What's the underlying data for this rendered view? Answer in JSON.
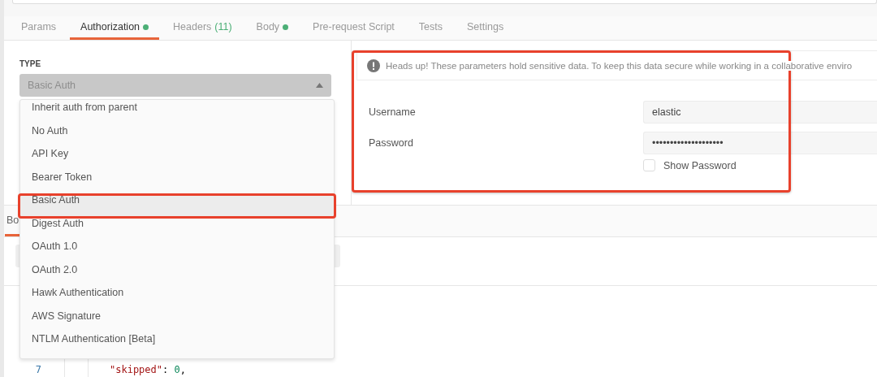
{
  "tabs": [
    {
      "label": "Params",
      "selected": false
    },
    {
      "label": "Authorization",
      "selected": true,
      "dot": true
    },
    {
      "label": "Headers",
      "selected": false,
      "count": "(11)"
    },
    {
      "label": "Body",
      "selected": false,
      "dot": true
    },
    {
      "label": "Pre-request Script",
      "selected": false
    },
    {
      "label": "Tests",
      "selected": false
    },
    {
      "label": "Settings",
      "selected": false
    }
  ],
  "auth_type": {
    "label": "TYPE",
    "value": "Basic Auth",
    "expanded": true,
    "options": [
      {
        "label": "Inherit auth from parent",
        "selected": false,
        "highlighted": false
      },
      {
        "label": "No Auth",
        "selected": false,
        "highlighted": false
      },
      {
        "label": "API Key",
        "selected": false,
        "highlighted": false
      },
      {
        "label": "Bearer Token",
        "selected": false,
        "highlighted": false
      },
      {
        "label": "Basic Auth",
        "selected": true,
        "highlighted": true
      },
      {
        "label": "Digest Auth",
        "selected": false,
        "highlighted": false
      },
      {
        "label": "OAuth 1.0",
        "selected": false,
        "highlighted": false
      },
      {
        "label": "OAuth 2.0",
        "selected": false,
        "highlighted": false
      },
      {
        "label": "Hawk Authentication",
        "selected": false,
        "highlighted": false
      },
      {
        "label": "AWS Signature",
        "selected": false,
        "highlighted": false
      },
      {
        "label": "NTLM Authentication [Beta]",
        "selected": false,
        "highlighted": false
      }
    ]
  },
  "params_panel": {
    "highlighted": true,
    "notice": "Heads up! These parameters hold sensitive data. To keep this data secure while working in a collaborative enviro",
    "fields": [
      {
        "label": "Username",
        "value": "elastic"
      },
      {
        "label": "Password",
        "value": "••••••••••••••••••••"
      }
    ],
    "show_password": {
      "label": "Show Password",
      "checked": false
    }
  },
  "response": {
    "tabs": [
      {
        "label": "Bo",
        "selected": true
      }
    ],
    "code_lines": [
      {
        "number": "7",
        "tokens": [
          {
            "kind": "key",
            "text": "\"skipped\""
          },
          {
            "kind": "punct",
            "text": ":"
          },
          {
            "kind": "number",
            "text": "0"
          },
          {
            "kind": "punct",
            "text": ","
          }
        ]
      }
    ]
  }
}
